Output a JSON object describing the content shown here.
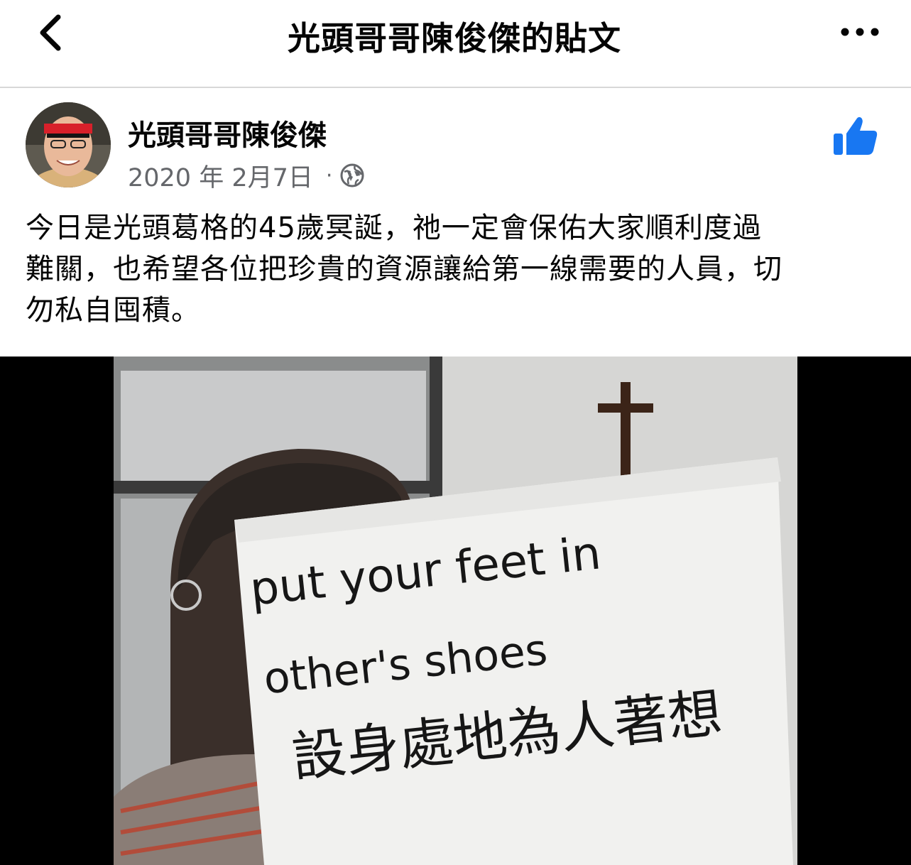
{
  "header": {
    "title": "光頭哥哥陳俊傑的貼文",
    "back_icon": "chevron-left-icon",
    "more_icon": "more-horizontal-icon"
  },
  "post": {
    "author": "光頭哥哥陳俊傑",
    "date": "2020 年 2月7日",
    "separator": "·",
    "privacy_icon": "globe-icon",
    "like_icon": "thumbs-up-icon",
    "like_color": "#1877F2",
    "text_lines": [
      "今日是光頭葛格的45歲冥誕，祂一定會保佑大家順利度過",
      "難關，也希望各位把珍貴的資源讓給第一線需要的人員，切",
      "勿私自囤積。"
    ],
    "photo": {
      "sign_line1": "put your feet in",
      "sign_line2": "other's shoes",
      "sign_line3": "設身處地為人著想"
    }
  }
}
